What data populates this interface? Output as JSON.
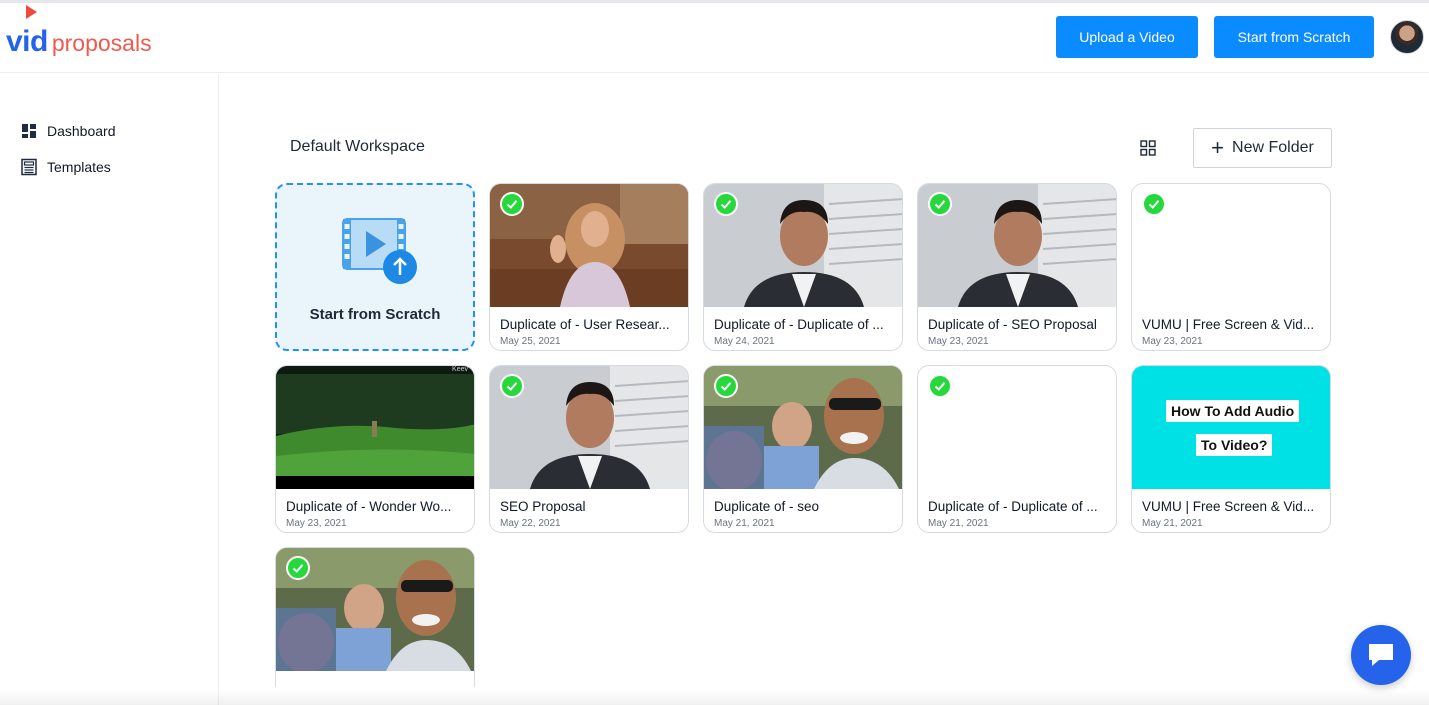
{
  "brand": {
    "logo_vid": "vid",
    "logo_proposals": "proposals",
    "primary": "#0a8bff",
    "accent": "#ef5a4f"
  },
  "header": {
    "upload_label": "Upload a Video",
    "scratch_label": "Start from Scratch",
    "avatar_icon": "user-avatar"
  },
  "sidebar": {
    "items": [
      {
        "label": "Dashboard",
        "icon": "dashboard-icon"
      },
      {
        "label": "Templates",
        "icon": "templates-icon"
      }
    ]
  },
  "workspace": {
    "title": "Default Workspace",
    "new_folder_label": "New Folder",
    "view_icon": "grid-view-icon",
    "scratch_card_label": "Start from Scratch"
  },
  "videos": [
    {
      "title": "Duplicate of - User Resear...",
      "date": "May 25, 2021",
      "thumb": "woman-waving",
      "checked": true
    },
    {
      "title": "Duplicate of - Duplicate of ...",
      "date": "May 24, 2021",
      "thumb": "man-suit",
      "checked": true
    },
    {
      "title": "Duplicate of - SEO Proposal",
      "date": "May 23, 2021",
      "thumb": "man-suit",
      "checked": true
    },
    {
      "title": "VUMU | Free Screen & Vid...",
      "date": "May 23, 2021",
      "thumb": "blank",
      "checked": true
    },
    {
      "title": "Duplicate of - Wonder Wo...",
      "date": "May 23, 2021",
      "thumb": "field",
      "checked": false
    },
    {
      "title": "SEO Proposal",
      "date": "May 22, 2021",
      "thumb": "man-suit",
      "checked": true
    },
    {
      "title": "Duplicate of - seo",
      "date": "May 21, 2021",
      "thumb": "selfie-crowd",
      "checked": true
    },
    {
      "title": "Duplicate of - Duplicate of ...",
      "date": "May 21, 2021",
      "thumb": "blank",
      "checked": true
    },
    {
      "title": "VUMU | Free Screen & Vid...",
      "date": "May 21, 2021",
      "thumb": "cyan-banner",
      "checked": false
    },
    {
      "title": "",
      "date": "",
      "thumb": "selfie-crowd",
      "checked": true
    }
  ],
  "banner_text": {
    "line1": "How To Add Audio",
    "line2": "To Video?"
  },
  "field_watermark": "Keev",
  "chat": {
    "icon": "chat-bubble-icon"
  }
}
